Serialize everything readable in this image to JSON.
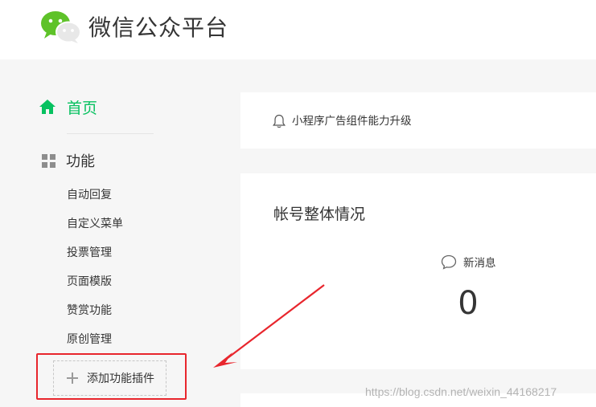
{
  "header": {
    "brand": "微信公众平台",
    "logo_icon": "wechat-logo-icon",
    "brand_color": "#07c160"
  },
  "sidebar": {
    "home": {
      "label": "首页",
      "icon": "home-icon"
    },
    "functions": {
      "label": "功能",
      "icon": "grid-icon"
    },
    "items": [
      {
        "label": "自动回复"
      },
      {
        "label": "自定义菜单"
      },
      {
        "label": "投票管理"
      },
      {
        "label": "页面模版"
      },
      {
        "label": "赞赏功能"
      },
      {
        "label": "原创管理"
      }
    ],
    "add_plugin": {
      "label": "添加功能插件",
      "icon": "plus-icon"
    }
  },
  "notice": {
    "text": "小程序广告组件能力升级",
    "icon": "bell-icon"
  },
  "account_overview": {
    "title": "帐号整体情况",
    "stats": [
      {
        "label": "新消息",
        "value": "0",
        "icon": "message-bubble-icon"
      }
    ]
  },
  "watermark": "https://blog.csdn.net/weixin_44168217",
  "annotation": {
    "highlight_color": "#e8262d"
  }
}
